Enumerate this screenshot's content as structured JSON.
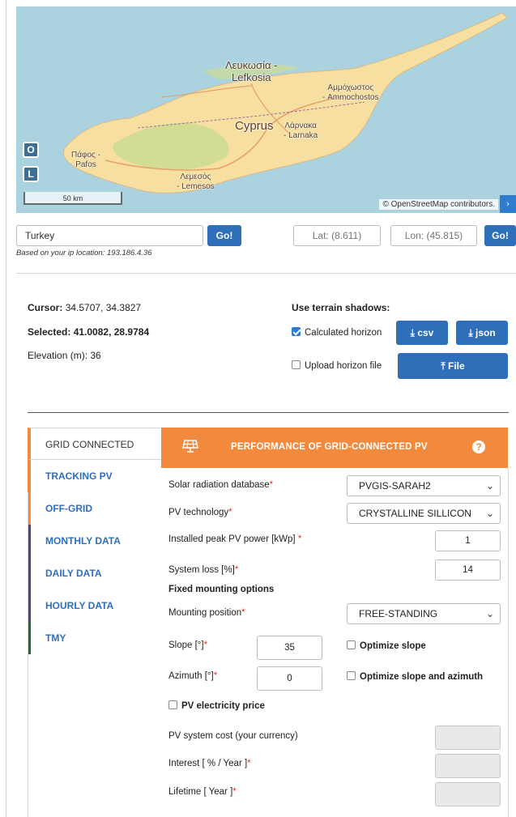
{
  "map": {
    "labels": {
      "nicosia": "Λευκωσία -\nLefkosia",
      "famagusta": "Αμμόχωστος\n- Ammochostos",
      "country": "Cyprus",
      "larnaka": "Λάρνακα\n- Larnaka",
      "paphos": "Πάφος -\nPafos",
      "limassol": "Λεμεσός\n- Lemesos"
    },
    "zoom_in": "O",
    "zoom_out": "L",
    "scale_label": "50 km",
    "attribution": "© OpenStreetMap contributors.",
    "attribution_toggle": "›",
    "colors": {
      "sea": "#aad3df",
      "land": "#f6dfa0",
      "highland": "#cddc92"
    }
  },
  "search": {
    "location_value": "Turkey",
    "go_label": "Go!",
    "lat_placeholder": "Lat: (8.611)",
    "lon_placeholder": "Lon: (45.815)",
    "go2_label": "Go!",
    "ip_note": "Based on your ip location: 193.186.4.36"
  },
  "info": {
    "cursor_label": "Cursor:",
    "cursor_value": "34.5707, 34.3827",
    "selected_label": "Selected:",
    "selected_value": "41.0082, 28.9784",
    "elevation": "Elevation (m): 36"
  },
  "terrain": {
    "title": "Use terrain shadows:",
    "calculated_label": "Calculated horizon",
    "csv_label": "csv",
    "json_label": "json",
    "upload_label": "Upload horizon file",
    "file_label": "File"
  },
  "tabs": [
    "GRID CONNECTED",
    "TRACKING PV",
    "OFF-GRID",
    "MONTHLY DATA",
    "DAILY DATA",
    "HOURLY DATA",
    "TMY"
  ],
  "panel": {
    "title": "PERFORMANCE OF GRID-CONNECTED PV",
    "help": "?",
    "accent": "#f28a3d",
    "fields": {
      "radiation_db_label": "Solar radiation database",
      "radiation_db_value": "PVGIS-SARAH2",
      "pv_tech_label": "PV technology",
      "pv_tech_value": "CRYSTALLINE SILLICON",
      "peak_power_label": "Installed peak PV power [kWp] ",
      "peak_power_value": "1",
      "system_loss_label": "System loss [%]",
      "system_loss_value": "14",
      "fixed_mount_heading": "Fixed mounting options",
      "mounting_label": "Mounting position",
      "mounting_value": "FREE-STANDING",
      "slope_label": "Slope [°]",
      "slope_value": "35",
      "optimize_slope_label": "Optimize slope",
      "azimuth_label": "Azimuth [°]",
      "azimuth_value": "0",
      "optimize_both_label": "Optimize slope and azimuth",
      "price_label": "PV electricity price",
      "cost_label": "PV system cost (your currency)",
      "interest_label": "Interest [ % / Year ]",
      "lifetime_label": "Lifetime [ Year ]",
      "required_mark": "*"
    }
  }
}
